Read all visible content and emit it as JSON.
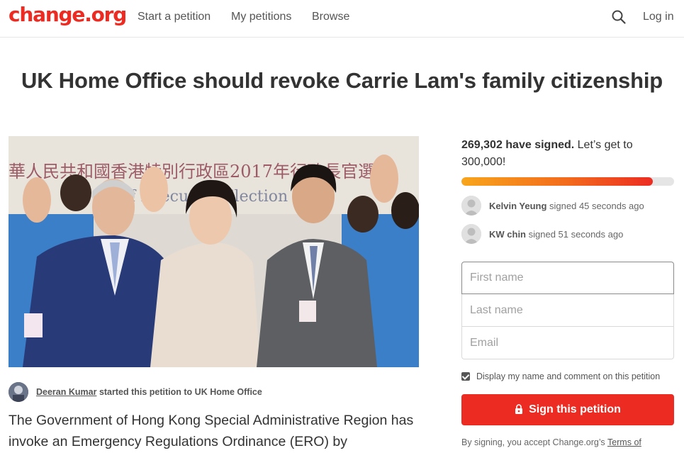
{
  "header": {
    "logo": "change.org",
    "nav": [
      "Start a petition",
      "My petitions",
      "Browse"
    ],
    "login": "Log in",
    "search_icon": "search-icon"
  },
  "petition": {
    "title": "UK Home Office should revoke Carrie Lam's family citizenship",
    "photo_banner": "華人民共和國香港特別行政區2017年行政長官選舉",
    "photo_banner_en": "Chief Executive Election",
    "starter_name": "Deeran Kumar",
    "starter_rest": "started this petition to UK Home Office",
    "body": "The Government of Hong Kong Special Administrative Region has invoke an Emergency Regulations Ordinance (ERO) by"
  },
  "signatures": {
    "count": "269,302 have signed.",
    "goal_text": "Let’s get to 300,000!",
    "progress_fraction": 0.9,
    "recent": [
      {
        "name": "Kelvin Yeung",
        "action": "signed 45 seconds ago"
      },
      {
        "name": "KW chin",
        "action": "signed 51 seconds ago"
      }
    ]
  },
  "form": {
    "first_name_placeholder": "First name",
    "last_name_placeholder": "Last name",
    "email_placeholder": "Email",
    "consent_label": "Display my name and comment on this petition",
    "sign_button": "Sign this petition",
    "disclaimer_prefix": "By signing, you accept Change.org’s",
    "disclaimer_link": "Terms of"
  },
  "colors": {
    "brand": "#ec2c22",
    "progress_start": "#f8a51c",
    "progress_end": "#ec2c22"
  }
}
